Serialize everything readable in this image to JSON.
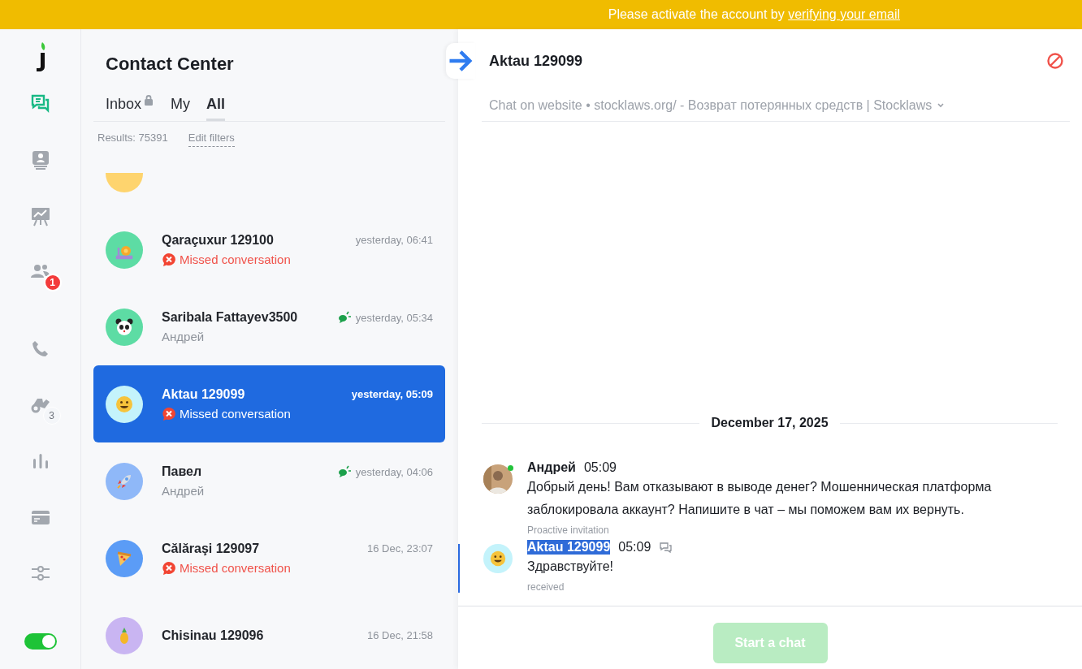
{
  "banner": {
    "text": "Please activate the account by ",
    "link": "verifying your email"
  },
  "rail": {
    "items": [
      {
        "kind": "chats",
        "selected": true
      },
      {
        "kind": "contacts",
        "selected": false
      },
      {
        "kind": "board",
        "selected": false
      },
      {
        "kind": "team",
        "selected": false,
        "badge": "1"
      },
      {
        "kind": "phone",
        "selected": false
      },
      {
        "kind": "tasks",
        "selected": false,
        "count": "3"
      },
      {
        "kind": "stats",
        "selected": false
      },
      {
        "kind": "billing",
        "selected": false
      },
      {
        "kind": "settings",
        "selected": false
      }
    ],
    "online": {
      "on": true
    }
  },
  "panel": {
    "title": "Contact Center",
    "tabs": [
      {
        "label": "Inbox",
        "locked": true,
        "selected": false
      },
      {
        "label": "My",
        "locked": false,
        "selected": false
      },
      {
        "label": "All",
        "locked": false,
        "selected": true
      }
    ],
    "results": "Results: 75391",
    "edit_filters": "Edit filters",
    "conversations": [
      {
        "name": "Qaraçuxur 129100",
        "time": "yesterday, 06:41",
        "status": "Missed conversation",
        "kind": "missed",
        "agent_replied": false,
        "selected": false,
        "avatar": {
          "kind": "snail",
          "color": "#5ddca4"
        }
      },
      {
        "name": "Saribala Fattayev3500",
        "time": "yesterday, 05:34",
        "status": "Андрей",
        "kind": "agent",
        "agent_replied": true,
        "selected": false,
        "avatar": {
          "kind": "panda",
          "color": "#5ddca4"
        }
      },
      {
        "name": "Aktau 129099",
        "time": "yesterday, 05:09",
        "status": "Missed conversation",
        "kind": "missed",
        "agent_replied": false,
        "selected": true,
        "avatar": {
          "kind": "smiley",
          "color": "#c4f3fb"
        }
      },
      {
        "name": "Павел",
        "time": "yesterday, 04:06",
        "status": "Андрей",
        "kind": "agent",
        "agent_replied": true,
        "selected": false,
        "avatar": {
          "kind": "rocket",
          "color": "#8fb8f8"
        }
      },
      {
        "name": "Călăraşi 129097",
        "time": "16 Dec, 23:07",
        "status": "Missed conversation",
        "kind": "missed",
        "agent_replied": false,
        "selected": false,
        "avatar": {
          "kind": "pizza",
          "color": "#5b9cf6"
        }
      },
      {
        "name": "Chisinau 129096",
        "time": "16 Dec, 21:58",
        "selected": false,
        "avatar": {
          "kind": "pineapple",
          "color": "#c9b5f2"
        }
      }
    ]
  },
  "chat": {
    "title": "Aktau 129099",
    "subtitle": "Chat on website • stocklaws.org/ - Возврат потерянных средств | Stocklaws",
    "date": "December 17, 2025",
    "messages": [
      {
        "kind": "agent",
        "author": "Андрей",
        "time": "05:09",
        "online": true,
        "text": "Добрый день! Вам отказывают в выводе денег? Мошенническая платформа заблокировала аккаунт? Напишите в чат – мы поможем вам их вернуть.",
        "note": "Proactive invitation",
        "current": false,
        "author_highlighted": false
      },
      {
        "kind": "visitor",
        "author": "Aktau 129099",
        "time": "05:09",
        "online": false,
        "text": "Здравствуйте!",
        "note": "received",
        "current": true,
        "author_highlighted": true
      }
    ],
    "start_button": {
      "label": "Start a chat",
      "disabled": true
    }
  }
}
